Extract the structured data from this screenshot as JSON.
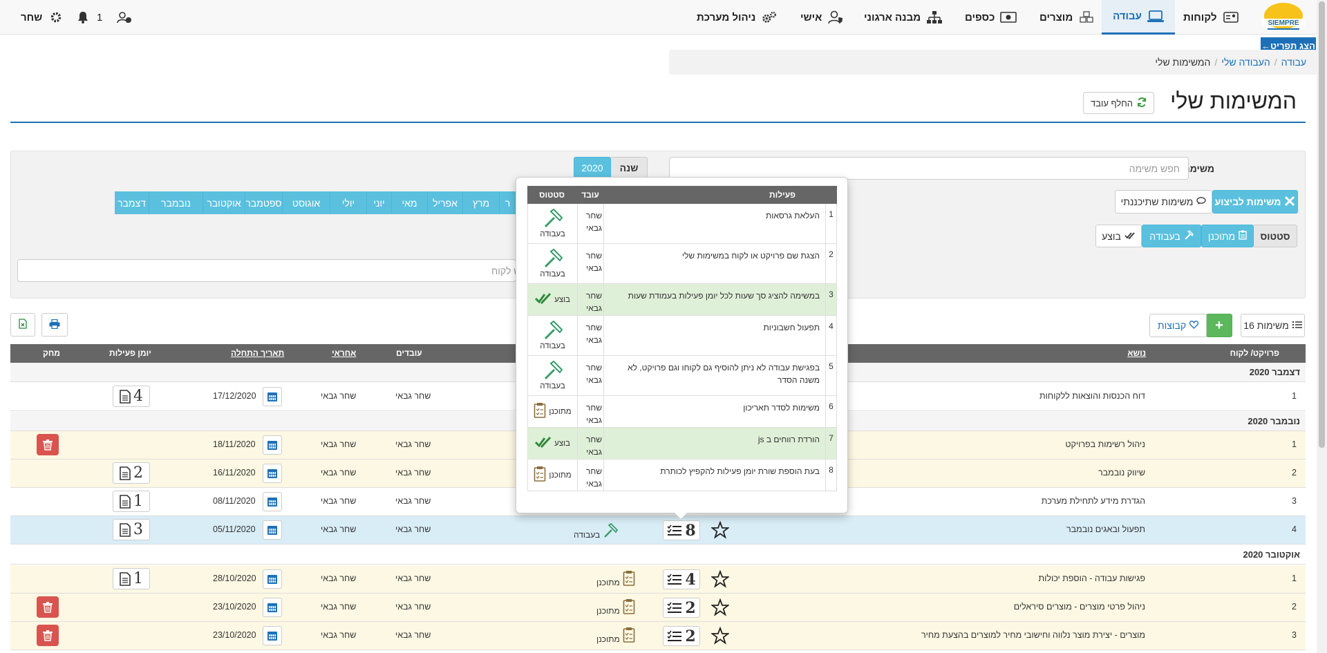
{
  "nav": {
    "items": [
      {
        "label": "לקוחות",
        "icon": "address-card-icon"
      },
      {
        "label": "עבודה",
        "icon": "laptop-icon"
      },
      {
        "label": "מוצרים",
        "icon": "cubes-icon"
      },
      {
        "label": "כספים",
        "icon": "money-icon"
      },
      {
        "label": "מבנה ארגוני",
        "icon": "sitemap-icon"
      },
      {
        "label": "אישי",
        "icon": "user-shield-icon"
      },
      {
        "label": "ניהול מערכת",
        "icon": "gears-icon"
      }
    ],
    "user_name": "שחר",
    "notifications_count": "1",
    "logo_text": "SIEMPRE",
    "show_menu_label": "הצג תפריט←"
  },
  "breadcrumb": {
    "items": [
      "עבודה",
      "העבודה שלי",
      "המשימות שלי"
    ]
  },
  "page": {
    "title": "המשימות שלי",
    "switch_employee_label": "החלף עובד"
  },
  "filters": {
    "task_label": "משימה",
    "task_placeholder": "חפש משימה",
    "year_label": "שנה",
    "year_value": "2020",
    "in_progress_tasks": "משימות לביצוע",
    "planned_tasks": "משימות שתיכננתי",
    "status_label": "סטטוס",
    "status_planned": "מתוכנן",
    "status_working": "בעבודה",
    "status_done": "בוצע",
    "months": [
      "מרץ",
      "אפריל",
      "מאי",
      "יוני",
      "יולי",
      "אוגוסט",
      "ספטמבר",
      "אוקטובר",
      "נובמבר",
      "דצמבר"
    ],
    "month_cut": "ר",
    "customer_placeholder_visible": "ש לקוח"
  },
  "toolbar": {
    "tasks_count_label": "משימות 16",
    "add_label": "+",
    "groups_label": "קבוצות"
  },
  "table": {
    "headers": {
      "project": "פרויקט/ לקוח",
      "subject": "נושא",
      "employees": "עובדים",
      "responsible": "אחראי",
      "start_date": "תאריך התחלה",
      "activity_log": "יומן פעילות",
      "delete": "מחק"
    },
    "groups": [
      {
        "title": "דצמבר 2020",
        "rows": [
          {
            "num": "1",
            "subject": "דוח הכנסות והוצאות ללקוחות",
            "employee": "שחר גבאי",
            "responsible": "שחר גבאי",
            "date": "17/12/2020",
            "log": "4"
          }
        ]
      },
      {
        "title": "נובמבר 2020",
        "rows": [
          {
            "num": "1",
            "subject": "ניהול רשימות בפרויקט",
            "employee": "שחר גבאי",
            "responsible": "שחר גבאי",
            "date": "18/11/2020"
          },
          {
            "num": "2",
            "subject": "שיווק נובמבר",
            "employee": "שחר גבאי",
            "responsible": "שחר גבאי",
            "date": "16/11/2020",
            "log": "2"
          },
          {
            "num": "3",
            "subject": "הגדרת מידע לתחילת מערכת",
            "employee": "שחר גבאי",
            "responsible": "שחר גבאי",
            "date": "08/11/2020",
            "log": "1"
          },
          {
            "num": "4",
            "subject": "תפעול ובאגים נובמבר",
            "activities": "8",
            "status": "בעבודה",
            "employee": "שחר גבאי",
            "responsible": "שחר גבאי",
            "date": "05/11/2020",
            "log": "3"
          }
        ]
      },
      {
        "title": "אוקטובר 2020",
        "rows": [
          {
            "num": "1",
            "subject": "פגישות עבודה - הוספת יכולות",
            "activities": "4",
            "status": "מתוכנן",
            "employee": "שחר גבאי",
            "responsible": "שחר גבאי",
            "date": "28/10/2020",
            "log": "1"
          },
          {
            "num": "2",
            "subject": "ניהול פרטי מוצרים - מוצרים סיראלים",
            "activities": "2",
            "status": "מתוכנן",
            "employee": "שחר גבאי",
            "responsible": "שחר גבאי",
            "date": "23/10/2020"
          },
          {
            "num": "3",
            "subject": "מוצרים - יצירת מוצר נלווה וחישובי מחיר למוצרים בהצעת מחיר",
            "activities": "2",
            "status": "מתוכנן",
            "employee": "שחר גבאי",
            "responsible": "שחר גבאי",
            "date": "23/10/2020"
          }
        ]
      }
    ]
  },
  "popover": {
    "headers": {
      "activities": "פעילות",
      "employee": "עובד",
      "status": "סטטוס"
    },
    "rows": [
      {
        "num": "1",
        "text": "העלאת גרסאות",
        "employee": "שחר גבאי",
        "status": "בעבודה"
      },
      {
        "num": "2",
        "text": "הצגת שם פרויקט או לקוח במשימות שלי",
        "employee": "שחר גבאי",
        "status": "בעבודה"
      },
      {
        "num": "3",
        "text": "במשימה להציג סך שעות לכל יומן פעילות בעמודת שעות",
        "employee": "שחר גבאי",
        "status": "בוצע"
      },
      {
        "num": "4",
        "text": "תפעול חשבוניות",
        "employee": "שחר גבאי",
        "status": "בעבודה"
      },
      {
        "num": "5",
        "text": "בפגישת עבודה לא ניתן להוסיף גם לקוחו וגם פרויקט, לא משנה הסדר",
        "employee": "שחר גבאי",
        "status": "בעבודה"
      },
      {
        "num": "6",
        "text": "משימות לסדר תאריכון",
        "employee": "שחר גבאי",
        "status": "מתוכנן"
      },
      {
        "num": "7",
        "text": "הורדת רווחים ב js",
        "employee": "שחר גבאי",
        "status": "בוצע"
      },
      {
        "num": "8",
        "text": "בעת הוספת שורת יומן פעילות להקפיץ לכותרת",
        "employee": "שחר גבאי",
        "status": "מתוכנן"
      }
    ]
  },
  "colors": {
    "brand": "#1d70b7",
    "info": "#5bc0de",
    "success": "#5cb85c",
    "danger": "#d9534f",
    "planned": "#8a6d3b",
    "working": "#3a9b6a"
  }
}
